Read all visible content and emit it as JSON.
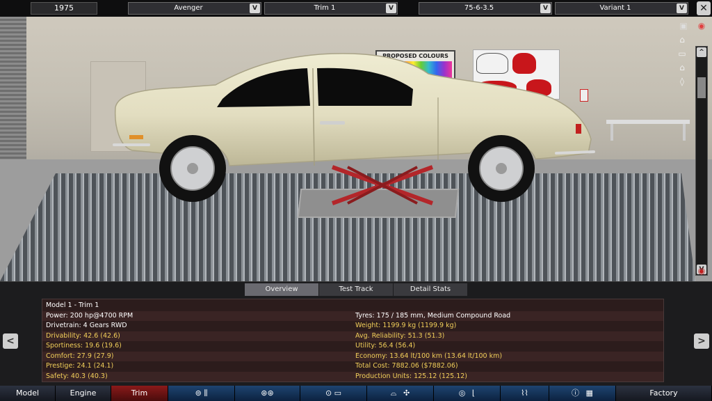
{
  "top": {
    "year": "1975",
    "model": "Avenger",
    "trim": "Trim 1",
    "engine": "75-6-3.5",
    "variant": "Variant 1",
    "drop_glyph": "V",
    "close_glyph": "✕"
  },
  "scene": {
    "poster_title": "PROPOSED COLOURS",
    "scroll_up": "^",
    "scroll_down": "V"
  },
  "subtabs": [
    "Overview",
    "Test Track",
    "Detail Stats"
  ],
  "stats": {
    "left": [
      {
        "label": "Model 1 - Trim 1",
        "color": "white"
      },
      {
        "label": "Power: 200 hp@4700 RPM",
        "color": "white"
      },
      {
        "label": "Drivetrain: 4 Gears RWD",
        "color": "white"
      },
      {
        "label": "Drivability: 42.6 (42.6)",
        "color": "gold"
      },
      {
        "label": "Sportiness: 19.6 (19.6)",
        "color": "gold"
      },
      {
        "label": "Comfort: 27.9 (27.9)",
        "color": "gold"
      },
      {
        "label": "Prestige: 24.1 (24.1)",
        "color": "gold"
      },
      {
        "label": "Safety: 40.3 (40.3)",
        "color": "gold"
      }
    ],
    "right": [
      {
        "label": "",
        "color": "white"
      },
      {
        "label": "Tyres: 175 / 185 mm, Medium Compound Road",
        "color": "white"
      },
      {
        "label": "Weight: 1199.9 kg (1199.9 kg)",
        "color": "gold"
      },
      {
        "label": "Avg. Reliability: 51.3 (51.3)",
        "color": "gold"
      },
      {
        "label": "Utility: 56.4 (56.4)",
        "color": "gold"
      },
      {
        "label": "Economy: 13.64 lt/100 km (13.64 lt/100 km)",
        "color": "gold"
      },
      {
        "label": "Total Cost: 7882.06 ($7882.06)",
        "color": "gold"
      },
      {
        "label": "Production Units: 125.12 (125.12)",
        "color": "gold"
      }
    ],
    "prev": "<",
    "next": ">"
  },
  "nav": {
    "model": "Model",
    "engine": "Engine",
    "trim": "Trim",
    "factory": "Factory"
  },
  "colors": {
    "accent_red": "#8a1a1a",
    "stat_gold": "#f2cf5a",
    "car_body": "#e6e2c6"
  },
  "icons": [
    "camera-icon",
    "eye-icon",
    "car-front-icon",
    "car-side-icon",
    "car-rear-icon",
    "car-top-icon",
    "gearbox-icon",
    "wheels-icon",
    "chassis-icon",
    "body-icon",
    "fan-icon",
    "steering-wheel-icon",
    "seat-icon",
    "suspension-icon",
    "info-icon",
    "checkered-flag-icon"
  ]
}
